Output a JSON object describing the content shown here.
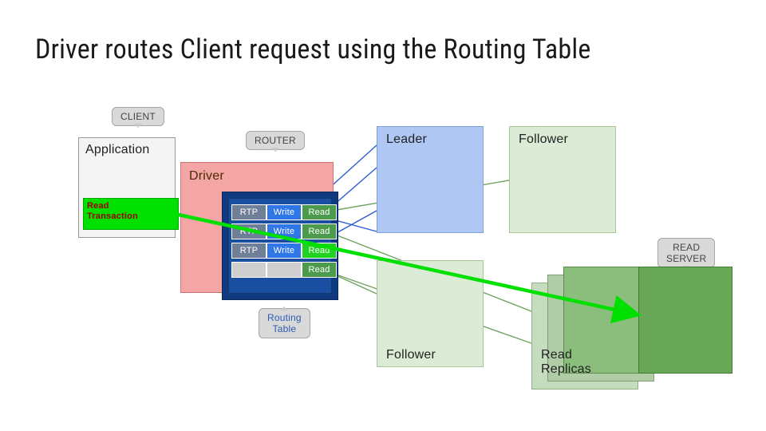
{
  "title": "Driver routes Client request using the Routing Table",
  "callouts": {
    "client": "CLIENT",
    "router": "ROUTER",
    "routing_table": "Routing\nTable",
    "read_server": "READ\nSERVER"
  },
  "application": {
    "label": "Application",
    "read_tx": "Read\nTransaction"
  },
  "driver": {
    "label": "Driver"
  },
  "routing_table": {
    "rows": [
      {
        "rtp": "RTP",
        "write": "Write",
        "read": "Read"
      },
      {
        "rtp": "RTP",
        "write": "Write",
        "read": "Read"
      },
      {
        "rtp": "RTP",
        "write": "Write",
        "read": "Read"
      }
    ],
    "extra_read": "Read"
  },
  "nodes": {
    "leader": "Leader",
    "follower1": "Follower",
    "follower2": "Follower",
    "read_replicas": "Read\nReplicas"
  },
  "chart_data": {
    "type": "diagram",
    "description": "Architecture diagram: a Client Application sends a Read Transaction to a Driver (Router). The Driver holds a Routing Table with rows of RTP / Write / Read endpoints. Write endpoints route to the Leader; Read endpoints route to Followers and Read Replicas. The highlighted green Read Transaction path goes from the Application through a Read entry in the Routing Table to a Read Server (one of the Read Replicas).",
    "entities": [
      "Application",
      "Driver",
      "Routing Table",
      "Leader",
      "Follower",
      "Follower",
      "Read Replicas",
      "Read Server"
    ],
    "edges": [
      {
        "from": "Application",
        "to": "Driver",
        "label": "Read Transaction",
        "highlight": true
      },
      {
        "from": "RoutingTable.Write",
        "to": "Leader"
      },
      {
        "from": "RoutingTable.Write",
        "to": "Leader"
      },
      {
        "from": "RoutingTable.Write",
        "to": "Leader"
      },
      {
        "from": "RoutingTable.Read",
        "to": "Follower"
      },
      {
        "from": "RoutingTable.Read",
        "to": "Follower"
      },
      {
        "from": "RoutingTable.Read",
        "to": "Read Replicas"
      },
      {
        "from": "RoutingTable.Read",
        "to": "Read Server",
        "highlight": true
      }
    ]
  }
}
